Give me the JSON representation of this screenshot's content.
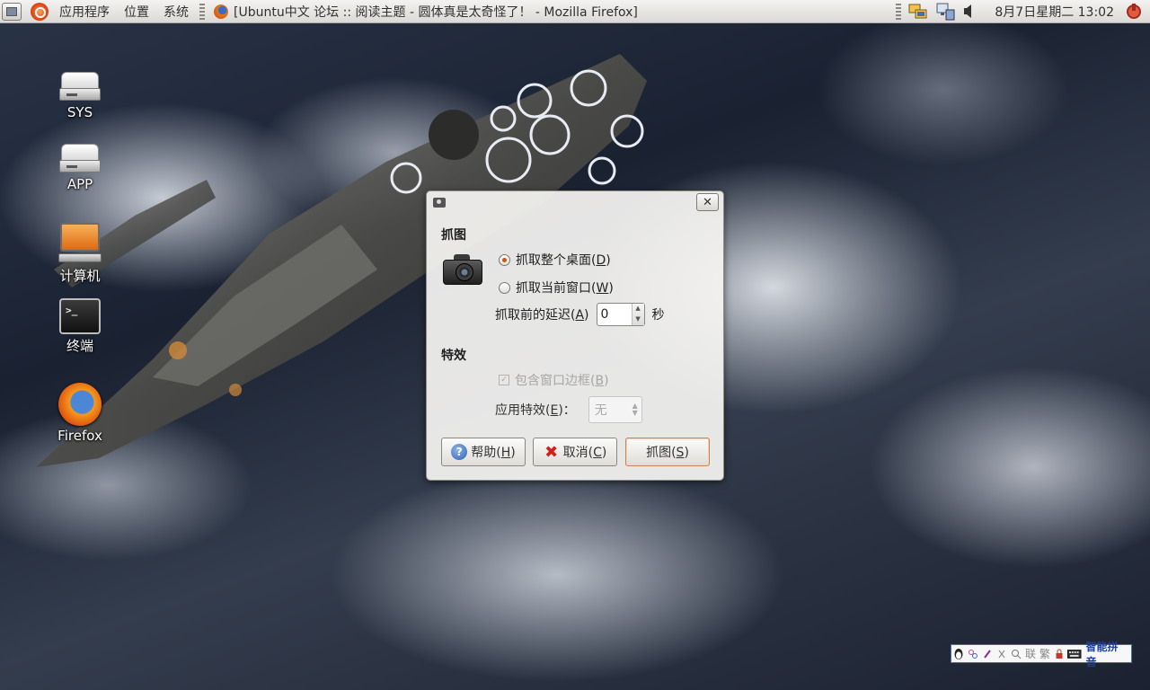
{
  "top_panel": {
    "menus": [
      "应用程序",
      "位置",
      "系统"
    ],
    "active_window_title": "[Ubuntu中文 论坛 :: 阅读主题 - 圆体真是太奇怪了！ - Mozilla Firefox]",
    "clock": "8月7日星期二 13:02",
    "tray_icons": [
      "network-icon",
      "network-manager-icon",
      "volume-icon"
    ]
  },
  "desktop": {
    "icons": [
      {
        "label": "SYS",
        "icon": "drive-icon"
      },
      {
        "label": "APP",
        "icon": "drive-icon"
      },
      {
        "label": "计算机",
        "icon": "computer-icon"
      },
      {
        "label": "终端",
        "icon": "terminal-icon"
      },
      {
        "label": "Firefox",
        "icon": "firefox-icon"
      }
    ]
  },
  "dialog": {
    "capture_section": "抓图",
    "option_desktop": {
      "text": "抓取整个桌面(",
      "key": "D",
      "end": ")",
      "selected": true
    },
    "option_window": {
      "text": "抓取当前窗口(",
      "key": "W",
      "end": ")",
      "selected": false
    },
    "delay": {
      "text": "抓取前的延迟(",
      "key": "A",
      "end": ")",
      "value": "0",
      "unit": "秒"
    },
    "effects_section": "特效",
    "include_border": {
      "text": "包含窗口边框(",
      "key": "B",
      "end": ")",
      "checked": true,
      "enabled": false
    },
    "apply_effect": {
      "text": "应用特效(",
      "key": "E",
      "end": ")：",
      "value": "无"
    },
    "buttons": {
      "help": {
        "text": "帮助(",
        "key": "H",
        "end": ")"
      },
      "cancel": {
        "text": "取消(",
        "key": "C",
        "end": ")"
      },
      "capture": {
        "text": "抓图(",
        "key": "S",
        "end": ")"
      }
    }
  },
  "input_method": {
    "cells": [
      "联",
      "繁"
    ],
    "label": "智能拼音"
  },
  "colors": {
    "accent": "#d4540e",
    "panel_bg": "#dcdad5",
    "ime_border": "#4470b5"
  }
}
